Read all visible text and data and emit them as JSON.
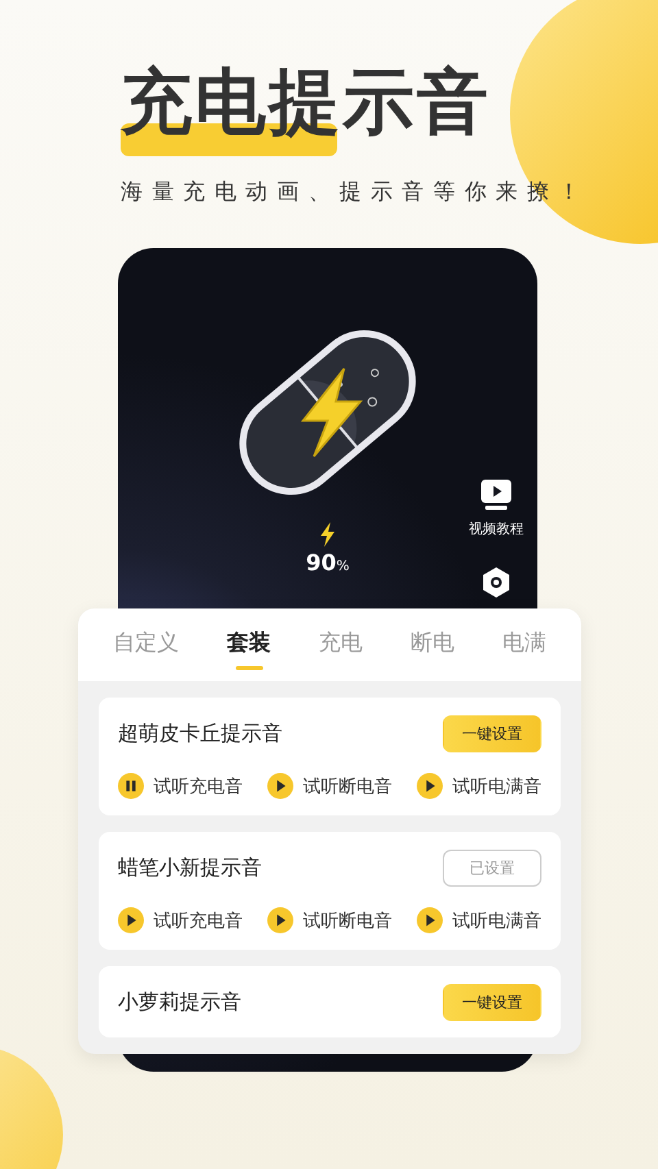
{
  "headline": "充电提示音",
  "subtitle": "海量充电动画、提示音等你来撩！",
  "phone": {
    "charge_value": "90",
    "charge_unit": "%",
    "side_buttons": [
      {
        "kind": "video",
        "label": "视频教程"
      },
      {
        "kind": "settings"
      }
    ]
  },
  "tabs": [
    {
      "label": "自定义",
      "selected": false
    },
    {
      "label": "套装",
      "selected": true
    },
    {
      "label": "充电",
      "selected": false
    },
    {
      "label": "断电",
      "selected": false
    },
    {
      "label": "电满",
      "selected": false
    }
  ],
  "sound_sets": [
    {
      "name": "超萌皮卡丘提示音",
      "button": "一键设置",
      "applied": false,
      "previews": [
        {
          "label": "试听充电音",
          "playing": true
        },
        {
          "label": "试听断电音",
          "playing": false
        },
        {
          "label": "试听电满音",
          "playing": false
        }
      ]
    },
    {
      "name": "蜡笔小新提示音",
      "button": "已设置",
      "applied": true,
      "previews": [
        {
          "label": "试听充电音",
          "playing": false
        },
        {
          "label": "试听断电音",
          "playing": false
        },
        {
          "label": "试听电满音",
          "playing": false
        }
      ]
    },
    {
      "name": "小萝莉提示音",
      "button": "一键设置",
      "applied": false
    }
  ]
}
